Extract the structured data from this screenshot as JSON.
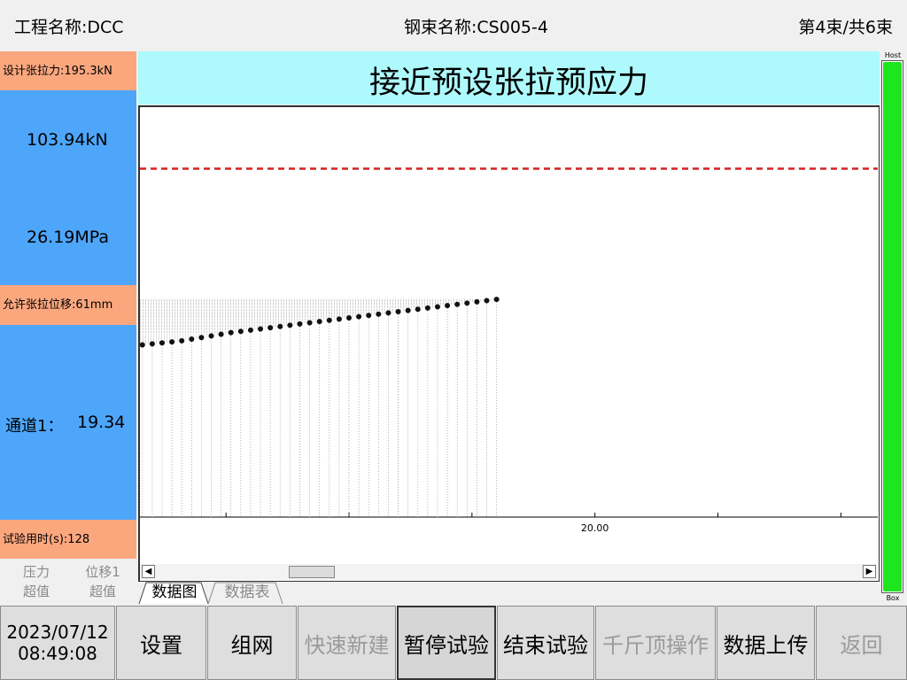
{
  "header": {
    "project": "工程名称:DCC",
    "strand": "钢束名称:CS005-4",
    "counter": "第4束/共6束"
  },
  "left_panel": {
    "design_force": "设计张拉力:195.3kN",
    "force_value": "103.94kN",
    "pressure_value": "26.19MPa",
    "allowed_disp": "允许张拉位移:61mm",
    "channel_label": "通道1：",
    "channel_value": "19.34",
    "elapsed": "试验用时(s):128",
    "legend": {
      "pressure": "压力",
      "pressure_status": "超值",
      "disp": "位移1",
      "disp_status": "超值"
    }
  },
  "status": "接近预设张拉预应力",
  "tabs": [
    "数据图",
    "数据表"
  ],
  "gauge": {
    "top_label": "Host",
    "bottom_label": "Box",
    "fill_fraction": 1.0,
    "color": "#1ee61e"
  },
  "datetime": {
    "date": "2023/07/12",
    "time": "08:49:08"
  },
  "buttons": {
    "settings": "设置",
    "network": "组网",
    "quick_new": "快速新建",
    "pause": "暂停试验",
    "end": "结束试验",
    "jack": "千斤顶操作",
    "upload": "数据上传",
    "back": "返回"
  },
  "chart_data": {
    "type": "scatter",
    "x_tick_labels": [
      "20.00"
    ],
    "x_ticks": [
      5,
      10,
      15,
      20,
      25,
      30
    ],
    "xlim": [
      1.5,
      31.5
    ],
    "ylim": [
      0,
      200
    ],
    "target_line": 170,
    "series": [
      {
        "x": [
          1.6,
          2.0,
          2.4,
          2.8,
          3.2,
          3.6,
          4.0,
          4.4,
          4.8,
          5.2,
          5.6,
          6.0,
          6.4,
          6.8,
          7.2,
          7.6,
          8.0,
          8.4,
          8.8,
          9.2,
          9.6,
          10.0,
          10.4,
          10.8,
          11.2,
          11.6,
          12.0,
          12.4,
          12.8,
          13.2,
          13.6,
          14.0,
          14.4,
          14.8,
          15.2,
          15.6,
          16.0
        ],
        "y": [
          84,
          84.5,
          85,
          85.5,
          86,
          86.8,
          87.6,
          88.4,
          89.2,
          90,
          90.6,
          91.2,
          91.8,
          92.4,
          93,
          93.6,
          94.2,
          94.8,
          95.4,
          96,
          96.6,
          97.2,
          97.8,
          98.4,
          99,
          99.6,
          100.2,
          100.8,
          101.4,
          102,
          102.6,
          103.2,
          103.8,
          104.4,
          105,
          105.6,
          106.2
        ]
      }
    ]
  }
}
